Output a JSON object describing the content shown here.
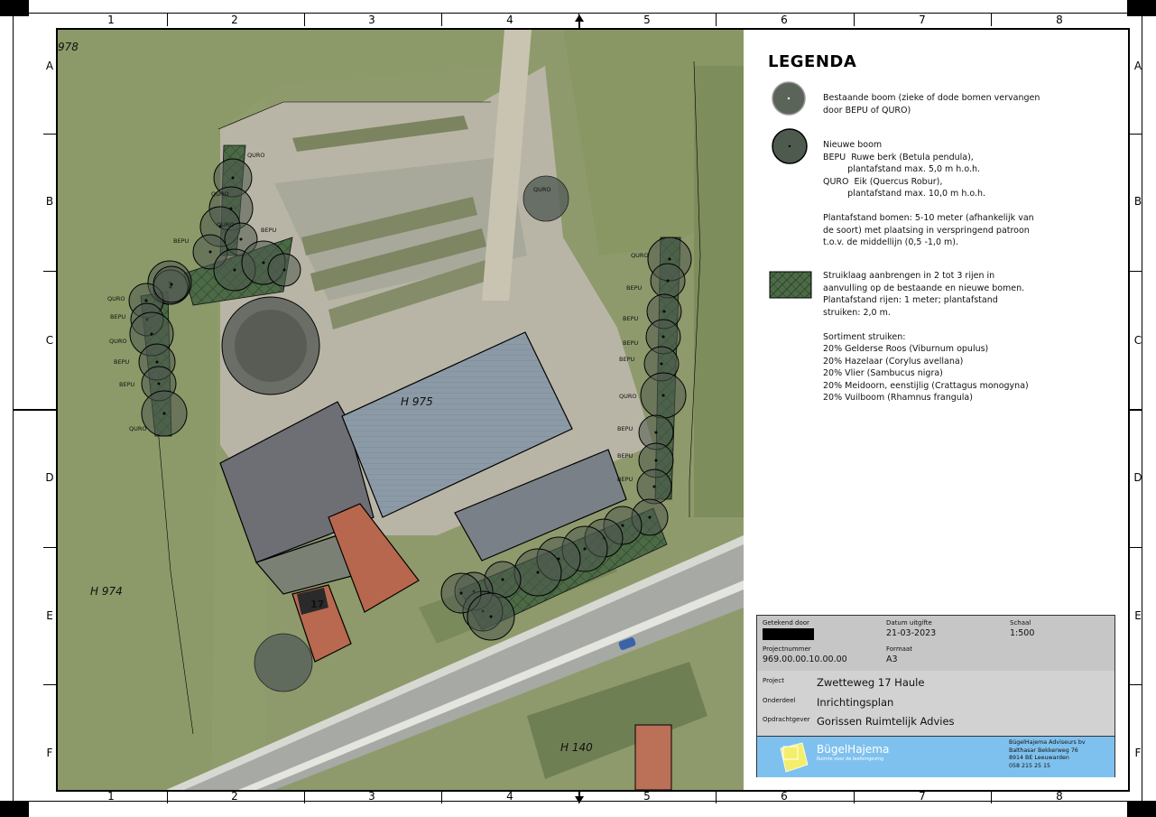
{
  "sheet": {
    "columns": [
      "1",
      "2",
      "3",
      "4",
      "5",
      "6",
      "7",
      "8"
    ],
    "rows": [
      "A",
      "B",
      "C",
      "D",
      "E",
      "F"
    ]
  },
  "map": {
    "labels": {
      "h978": "978",
      "h975": "H 975",
      "h974": "H 974",
      "h140": "H 140",
      "house": "17"
    },
    "tree_labels_left": [
      "QURO",
      "QURO",
      "QURO",
      "BEPU",
      "BEPU",
      "QURO",
      "BEPU",
      "QURO",
      "BEPU",
      "BEPU",
      "QURO"
    ],
    "tree_labels_right": [
      "QURO",
      "BEPU",
      "BEPU",
      "BEPU",
      "BEPU",
      "QURO",
      "BEPU",
      "BEPU",
      "BEPU"
    ],
    "tree_label_center": "QURO"
  },
  "legend": {
    "title": "LEGENDA",
    "existing_tree": "Bestaande boom (zieke of dode bomen vervangen\ndoor BEPU of QURO)",
    "new_tree": "Nieuwe boom\nBEPU  Ruwe berk (Betula pendula),\n         plantafstand max. 5,0 m h.o.h.\nQURO  Eik (Quercus Robur),\n         plantafstand max. 10,0 m h.o.h.\n\nPlantafstand bomen: 5-10 meter (afhankelijk van\nde soort) met plaatsing in verspringend patroon\nt.o.v. de middellijn (0,5 -1,0 m).",
    "shrub_layer": "Struiklaag aanbrengen in 2 tot 3 rijen in\naanvulling op de bestaande en nieuwe bomen.\nPlantafstand rijen: 1 meter; plantafstand\nstruiken: 2,0 m.\n\nSortiment struiken:\n20% Gelderse Roos (Viburnum opulus)\n20% Hazelaar (Corylus avellana)\n20% Vlier (Sambucus nigra)\n20% Meidoorn, eenstijlig (Crattagus monogyna)\n20% Vuilboom (Rhamnus frangula)"
  },
  "titleblock": {
    "drawn_by_label": "Getekend door",
    "date_label": "Datum uitgifte",
    "date_value": "21-03-2023",
    "scale_label": "Schaal",
    "scale_value": "1:500",
    "project_number_label": "Projectnummer",
    "project_number_value": "969.00.00.10.00.00",
    "format_label": "Formaat",
    "format_value": "A3",
    "project_label": "Project",
    "project_value": "Zwetteweg 17 Haule",
    "part_label": "Onderdeel",
    "part_value": "Inrichtingsplan",
    "client_label": "Opdrachtgever",
    "client_value": "Gorissen Ruimtelijk Advies",
    "company_name": "BügelHajema",
    "company_tagline": "Ruimte voor de leefomgeving",
    "company_address": "BügelHajema Adviseurs bv\nBalthasar Bekkerweg 76\n8914 BE Leeuwarden\n058 215 25 15"
  },
  "colors": {
    "tree_fill": "#4f5a4f",
    "shrub_fill": "#4b6a45",
    "titleblock_top": "#c6c6c6",
    "company_band": "#7fc1ee"
  }
}
